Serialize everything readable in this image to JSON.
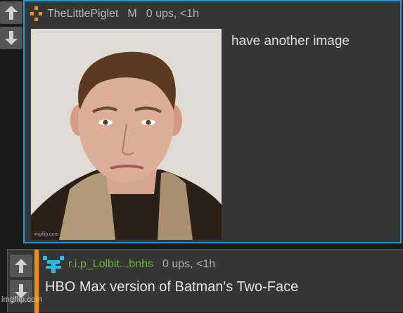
{
  "comment": {
    "username": "TheLittlePiglet",
    "badge": "M",
    "meta": "0 ups, <1h",
    "text": "have another image",
    "image_tag": "imgflip.com"
  },
  "reply": {
    "username": "r.i.p_Lolbit...bnhs",
    "meta": "0 ups, <1h",
    "text": "HBO Max version of Batman's Two-Face"
  },
  "watermark": "imgflip.com",
  "colors": {
    "comment_border": "#1b9bd8",
    "reply_accent": "#f28c0c",
    "reply_username": "#6fb52c",
    "logo_orange": "#f28c0c",
    "logo_blue": "#29b6e8"
  },
  "icons": [
    "arrow-up-icon",
    "arrow-down-icon",
    "user-logo-icon"
  ]
}
